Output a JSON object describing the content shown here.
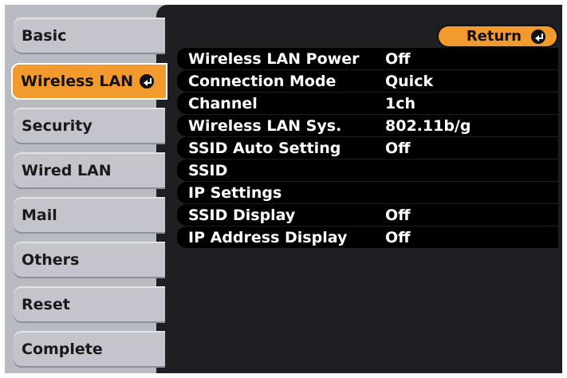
{
  "sidebar": {
    "tabs": [
      {
        "label": "Basic"
      },
      {
        "label": "Wireless LAN",
        "icon": "enter-icon",
        "active": true
      },
      {
        "label": "Security"
      },
      {
        "label": "Wired LAN"
      },
      {
        "label": "Mail"
      },
      {
        "label": "Others"
      },
      {
        "label": "Reset"
      },
      {
        "label": "Complete"
      }
    ]
  },
  "main": {
    "return_label": "Return",
    "return_icon": "enter-icon",
    "settings": [
      {
        "label": "Wireless LAN Power",
        "value": "Off"
      },
      {
        "label": "Connection Mode",
        "value": "Quick"
      },
      {
        "label": "Channel",
        "value": "1ch"
      },
      {
        "label": "Wireless LAN Sys.",
        "value": "802.11b/g"
      },
      {
        "label": "SSID Auto Setting",
        "value": "Off"
      },
      {
        "label": "SSID",
        "value": ""
      },
      {
        "label": "IP Settings",
        "value": ""
      },
      {
        "label": "SSID Display",
        "value": "Off"
      },
      {
        "label": "IP Address Display",
        "value": "Off"
      }
    ]
  },
  "colors": {
    "accent": "#f39a2e",
    "panel": "#1e1e23",
    "tab": "#c3c4cc",
    "frame": "#b9bbc3"
  }
}
